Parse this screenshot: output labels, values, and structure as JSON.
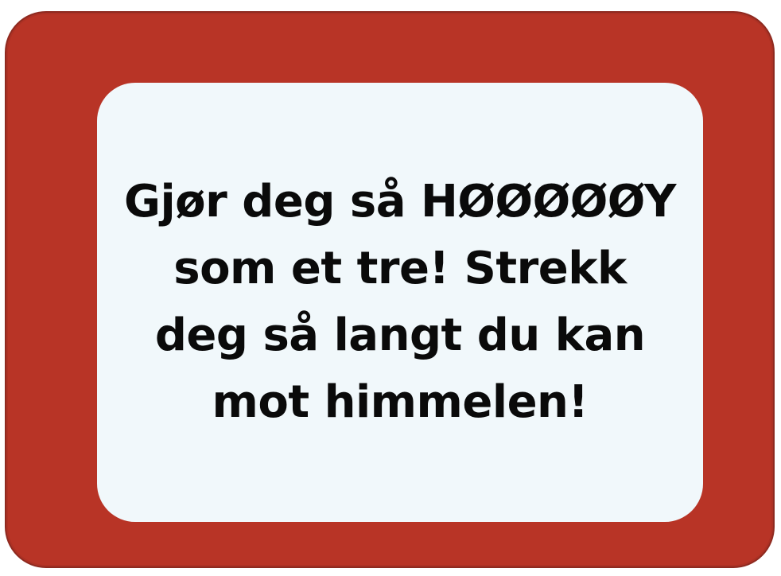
{
  "card": {
    "lines": [
      "Gjør deg så HØØØØØY",
      "som et tre! Strekk",
      "deg så langt du kan",
      "mot himmelen!"
    ]
  },
  "colors": {
    "frame": "#b83426",
    "panel": "#f1f8fb",
    "text": "#0a0a0a"
  }
}
